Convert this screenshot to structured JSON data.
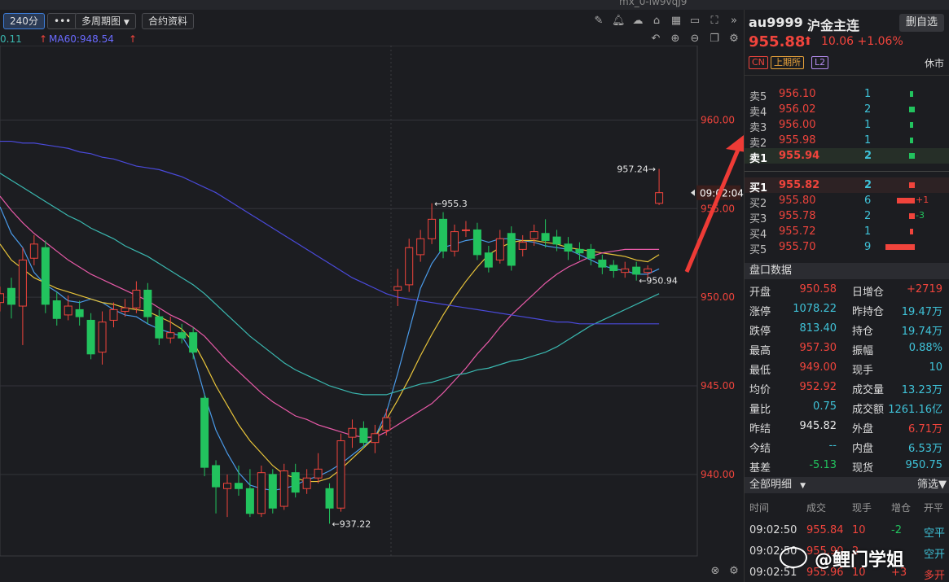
{
  "window": {
    "partial_title": "mx_0-iw9vqJ9"
  },
  "toolbar": {
    "period": "240分",
    "more": "•••",
    "multi_period": "多周期图",
    "contract_info": "合约资料"
  },
  "ma_legend": {
    "left_value": "0.11",
    "ma60": "MA60:948.54"
  },
  "chart_data": {
    "type": "candlestick",
    "y_ticks": [
      "960.00",
      "955.00",
      "950.00",
      "945.00",
      "940.00"
    ],
    "ylim": [
      935.4,
      964.2
    ],
    "current_price_label": "09:02:04",
    "annotations": [
      {
        "text": "957.24",
        "x": 31,
        "y": 957.24
      },
      {
        "text": "955.3",
        "x": 20,
        "y": 955.3
      },
      {
        "text": "950.94",
        "x": 31,
        "y": 950.94
      },
      {
        "text": "937.22",
        "x": 15,
        "y": 937.22
      }
    ],
    "candles": [
      {
        "o": 949.7,
        "c": 950.2,
        "h": 950.6,
        "l": 949.2
      },
      {
        "o": 950.5,
        "c": 949.6,
        "h": 951.1,
        "l": 948.8
      },
      {
        "o": 949.5,
        "c": 952.1,
        "h": 952.8,
        "l": 947.3
      },
      {
        "o": 952.2,
        "c": 953.0,
        "h": 953.5,
        "l": 951.8
      },
      {
        "o": 952.8,
        "c": 949.6,
        "h": 953.2,
        "l": 949.1
      },
      {
        "o": 949.8,
        "c": 948.8,
        "h": 950.3,
        "l": 948.4
      },
      {
        "o": 949.0,
        "c": 949.5,
        "h": 950.1,
        "l": 948.7
      },
      {
        "o": 949.3,
        "c": 948.9,
        "h": 949.8,
        "l": 948.4
      },
      {
        "o": 948.7,
        "c": 946.8,
        "h": 949.1,
        "l": 946.5
      },
      {
        "o": 946.9,
        "c": 948.6,
        "h": 949.2,
        "l": 946.2
      },
      {
        "o": 948.7,
        "c": 949.3,
        "h": 949.7,
        "l": 948.3
      },
      {
        "o": 949.2,
        "c": 949.4,
        "h": 949.9,
        "l": 948.9
      },
      {
        "o": 949.4,
        "c": 950.4,
        "h": 950.9,
        "l": 949.1
      },
      {
        "o": 950.4,
        "c": 948.9,
        "h": 950.8,
        "l": 948.5
      },
      {
        "o": 948.9,
        "c": 947.7,
        "h": 949.3,
        "l": 947.3
      },
      {
        "o": 947.7,
        "c": 948.0,
        "h": 948.9,
        "l": 947.4
      },
      {
        "o": 948.0,
        "c": 947.7,
        "h": 948.5,
        "l": 947.4
      },
      {
        "o": 948.0,
        "c": 946.9,
        "h": 948.3,
        "l": 946.5
      },
      {
        "o": 944.3,
        "c": 940.4,
        "h": 944.5,
        "l": 939.9
      },
      {
        "o": 940.5,
        "c": 939.3,
        "h": 940.8,
        "l": 937.8
      },
      {
        "o": 939.2,
        "c": 939.5,
        "h": 940.0,
        "l": 937.6
      },
      {
        "o": 939.5,
        "c": 939.2,
        "h": 940.5,
        "l": 938.8
      },
      {
        "o": 939.2,
        "c": 937.8,
        "h": 940.3,
        "l": 937.6
      },
      {
        "o": 937.8,
        "c": 940.1,
        "h": 940.5,
        "l": 937.6
      },
      {
        "o": 940.0,
        "c": 938.1,
        "h": 940.3,
        "l": 937.8
      },
      {
        "o": 938.2,
        "c": 940.2,
        "h": 940.6,
        "l": 938.0
      },
      {
        "o": 940.1,
        "c": 939.0,
        "h": 940.6,
        "l": 938.7
      },
      {
        "o": 939.2,
        "c": 939.8,
        "h": 940.3,
        "l": 938.9
      },
      {
        "o": 939.8,
        "c": 940.3,
        "h": 941.2,
        "l": 939.5
      },
      {
        "o": 939.2,
        "c": 938.1,
        "h": 939.5,
        "l": 937.22
      },
      {
        "o": 938.1,
        "c": 941.9,
        "h": 942.3,
        "l": 937.9
      },
      {
        "o": 942.1,
        "c": 942.6,
        "h": 943.1,
        "l": 941.5
      },
      {
        "o": 942.6,
        "c": 941.8,
        "h": 943.0,
        "l": 941.5
      },
      {
        "o": 941.8,
        "c": 942.3,
        "h": 942.8,
        "l": 941.2
      },
      {
        "o": 942.5,
        "c": 943.2,
        "h": 943.7,
        "l": 942.2
      },
      {
        "o": 950.4,
        "c": 950.6,
        "h": 951.6,
        "l": 949.5
      },
      {
        "o": 950.7,
        "c": 952.8,
        "h": 953.3,
        "l": 950.3
      },
      {
        "o": 952.4,
        "c": 953.3,
        "h": 953.8,
        "l": 952.0
      },
      {
        "o": 953.3,
        "c": 954.4,
        "h": 955.3,
        "l": 953.0
      },
      {
        "o": 954.4,
        "c": 952.6,
        "h": 954.8,
        "l": 952.2
      },
      {
        "o": 952.6,
        "c": 953.7,
        "h": 954.1,
        "l": 952.3
      },
      {
        "o": 953.8,
        "c": 953.8,
        "h": 954.3,
        "l": 953.4
      },
      {
        "o": 953.8,
        "c": 952.4,
        "h": 954.2,
        "l": 952.1
      },
      {
        "o": 952.5,
        "c": 951.7,
        "h": 952.9,
        "l": 951.4
      },
      {
        "o": 952.1,
        "c": 953.3,
        "h": 953.8,
        "l": 951.9
      },
      {
        "o": 953.6,
        "c": 951.8,
        "h": 954.0,
        "l": 951.5
      },
      {
        "o": 952.7,
        "c": 953.1,
        "h": 953.5,
        "l": 952.3
      },
      {
        "o": 953.3,
        "c": 953.7,
        "h": 954.1,
        "l": 952.9
      },
      {
        "o": 953.6,
        "c": 953.2,
        "h": 954.4,
        "l": 952.8
      },
      {
        "o": 953.4,
        "c": 953.0,
        "h": 953.8,
        "l": 952.6
      },
      {
        "o": 953.0,
        "c": 952.6,
        "h": 953.4,
        "l": 952.1
      },
      {
        "o": 952.7,
        "c": 952.5,
        "h": 953.1,
        "l": 952.1
      },
      {
        "o": 952.7,
        "c": 952.2,
        "h": 953.0,
        "l": 951.8
      },
      {
        "o": 952.1,
        "c": 951.7,
        "h": 952.4,
        "l": 951.3
      },
      {
        "o": 951.8,
        "c": 951.5,
        "h": 952.1,
        "l": 951.1
      },
      {
        "o": 951.4,
        "c": 951.6,
        "h": 952.0,
        "l": 951.1
      },
      {
        "o": 951.7,
        "c": 951.3,
        "h": 952.0,
        "l": 950.94
      },
      {
        "o": 951.4,
        "c": 951.6,
        "h": 951.8,
        "l": 951.1
      },
      {
        "o": 955.3,
        "c": 955.9,
        "h": 957.24,
        "l": 955.2
      }
    ],
    "series": [
      {
        "color": "#4a9ae8",
        "values": [
          955.1,
          953.6,
          952.8,
          951.4,
          950.7,
          950.3,
          949.8,
          949.7,
          949.9,
          949.7,
          949.3,
          949.0,
          948.9,
          948.5,
          948.2,
          948.0,
          947.8,
          946.8,
          944.5,
          942.5,
          941.2,
          940.1,
          939.4,
          939.2,
          939.1,
          939.2,
          939.4,
          939.7,
          939.9,
          940.2,
          940.6,
          941.1,
          941.6,
          942.1,
          943.5,
          945.7,
          948.1,
          950.5,
          951.9,
          952.8,
          953.0,
          953.2,
          953.3,
          953.1,
          953.3,
          953.3,
          953.2,
          953.1,
          952.9,
          952.8,
          952.7,
          952.4,
          952.1,
          951.8,
          951.6,
          951.5,
          951.3,
          951.3,
          951.6
        ]
      },
      {
        "color": "#e8c43a",
        "values": [
          953.0,
          952.1,
          951.6,
          951.1,
          950.8,
          950.5,
          950.3,
          950.1,
          949.9,
          949.7,
          949.6,
          949.4,
          949.3,
          949.2,
          948.9,
          948.6,
          948.2,
          947.5,
          946.3,
          945.0,
          943.9,
          942.8,
          941.9,
          941.2,
          940.5,
          940.0,
          939.8,
          939.6,
          939.6,
          939.8,
          940.3,
          940.9,
          941.5,
          942.1,
          943.1,
          944.2,
          945.4,
          946.7,
          947.9,
          949.0,
          950.0,
          950.9,
          951.7,
          952.4,
          952.8,
          953.1,
          953.2,
          953.2,
          953.1,
          953.0,
          952.8,
          952.7,
          952.6,
          952.5,
          952.4,
          952.3,
          952.1,
          952.0,
          952.4
        ]
      },
      {
        "color": "#e85aa8",
        "values": [
          955.7,
          954.9,
          954.2,
          953.6,
          953.1,
          952.6,
          952.1,
          951.7,
          951.3,
          951.0,
          950.7,
          950.4,
          950.1,
          949.8,
          949.4,
          949.0,
          948.7,
          948.3,
          947.8,
          947.1,
          946.4,
          945.8,
          945.2,
          944.6,
          944.1,
          943.7,
          943.3,
          943.1,
          942.8,
          942.6,
          942.4,
          942.2,
          942.1,
          942.1,
          942.4,
          942.8,
          943.2,
          943.6,
          944.0,
          944.6,
          945.3,
          946.0,
          946.8,
          947.5,
          948.3,
          949.0,
          949.6,
          950.2,
          950.8,
          951.3,
          951.7,
          952.0,
          952.3,
          952.5,
          952.6,
          952.7,
          952.7,
          952.7,
          952.7
        ]
      },
      {
        "color": "#3ab8b0",
        "values": [
          957.0,
          956.6,
          956.2,
          955.8,
          955.4,
          955.0,
          954.6,
          954.3,
          953.9,
          953.6,
          953.3,
          952.9,
          952.6,
          952.3,
          951.9,
          951.5,
          951.1,
          950.7,
          950.2,
          949.6,
          949.0,
          948.4,
          947.8,
          947.3,
          946.8,
          946.3,
          945.9,
          945.6,
          945.3,
          945.0,
          944.8,
          944.6,
          944.5,
          944.5,
          944.5,
          944.7,
          944.9,
          945.1,
          945.2,
          945.4,
          945.6,
          945.7,
          945.9,
          946.0,
          946.2,
          946.4,
          946.5,
          946.7,
          946.9,
          947.2,
          947.6,
          948.0,
          948.4,
          948.7,
          949.0,
          949.3,
          949.6,
          949.9,
          950.2
        ]
      },
      {
        "color": "#4a4adb",
        "values": [
          958.8,
          958.8,
          958.7,
          958.7,
          958.6,
          958.5,
          958.4,
          958.2,
          958.1,
          957.9,
          957.8,
          957.6,
          957.4,
          957.3,
          957.2,
          957.0,
          956.8,
          956.5,
          956.2,
          955.9,
          955.5,
          955.1,
          954.7,
          954.3,
          953.9,
          953.5,
          953.1,
          952.7,
          952.3,
          951.9,
          951.5,
          951.1,
          950.8,
          950.5,
          950.2,
          950.0,
          949.9,
          949.8,
          949.7,
          949.6,
          949.5,
          949.4,
          949.3,
          949.2,
          949.1,
          949.0,
          948.9,
          948.8,
          948.7,
          948.6,
          948.6,
          948.5,
          948.5,
          948.5,
          948.5,
          948.5,
          948.5,
          948.5,
          948.5
        ]
      }
    ]
  },
  "panel": {
    "symbol": "au9999",
    "name": "沪金主连",
    "delete_btn": "删自选",
    "price": "955.88",
    "change": "10.06",
    "change_pct": "+1.06%",
    "tags": [
      "CN",
      "上期所",
      "L2"
    ],
    "status": "休市",
    "asks": [
      {
        "label": "卖5",
        "price": "956.10",
        "vol": "1",
        "bar": 0.1
      },
      {
        "label": "卖4",
        "price": "956.02",
        "vol": "2",
        "bar": 0.2
      },
      {
        "label": "卖3",
        "price": "956.00",
        "vol": "1",
        "bar": 0.1
      },
      {
        "label": "卖2",
        "price": "955.98",
        "vol": "1",
        "bar": 0.1
      },
      {
        "label": "卖1",
        "price": "955.94",
        "vol": "2",
        "bar": 0.2
      }
    ],
    "bids": [
      {
        "label": "买1",
        "price": "955.82",
        "vol": "2",
        "bar": 0.2,
        "delta": ""
      },
      {
        "label": "买2",
        "price": "955.80",
        "vol": "6",
        "bar": 0.62,
        "delta": "+1"
      },
      {
        "label": "买3",
        "price": "955.78",
        "vol": "2",
        "bar": 0.2,
        "delta": "-3"
      },
      {
        "label": "买4",
        "price": "955.72",
        "vol": "1",
        "bar": 0.1,
        "delta": ""
      },
      {
        "label": "买5",
        "price": "955.70",
        "vol": "9",
        "bar": 1.0,
        "delta": ""
      }
    ],
    "data_header": "盘口数据",
    "data_rows": [
      {
        "l1": "开盘",
        "v1": "950.58",
        "c1": "red",
        "l2": "日增仓",
        "v2": "+2719",
        "c2": "red"
      },
      {
        "l1": "涨停",
        "v1": "1078.22",
        "c1": "cyan",
        "l2": "昨持仓",
        "v2": "19.47万",
        "c2": "cyan"
      },
      {
        "l1": "跌停",
        "v1": "813.40",
        "c1": "cyan",
        "l2": "持仓",
        "v2": "19.74万",
        "c2": "cyan"
      },
      {
        "l1": "最高",
        "v1": "957.30",
        "c1": "red",
        "l2": "振幅",
        "v2": "0.88%",
        "c2": "cyan"
      },
      {
        "l1": "最低",
        "v1": "949.00",
        "c1": "red",
        "l2": "现手",
        "v2": "10",
        "c2": "cyan"
      },
      {
        "l1": "均价",
        "v1": "952.92",
        "c1": "red",
        "l2": "成交量",
        "v2": "13.23万",
        "c2": "cyan"
      },
      {
        "l1": "量比",
        "v1": "0.75",
        "c1": "cyan",
        "l2": "成交额",
        "v2": "1261.16亿",
        "c2": "cyan"
      },
      {
        "l1": "昨结",
        "v1": "945.82",
        "c1": "white",
        "l2": "外盘",
        "v2": "6.71万",
        "c2": "red"
      },
      {
        "l1": "今结",
        "v1": "--",
        "c1": "cyan",
        "l2": "内盘",
        "v2": "6.53万",
        "c2": "cyan"
      },
      {
        "l1": "基差",
        "v1": "-5.13",
        "c1": "green",
        "l2": "现货",
        "v2": "950.75",
        "c2": "cyan"
      }
    ],
    "trades_header": "全部明细",
    "filter": "筛选",
    "trades_cols": [
      "时间",
      "成交",
      "现手",
      "增仓",
      "开平"
    ],
    "trades": [
      {
        "time": "09:02:50",
        "price": "955.84",
        "vol": "10",
        "oi": "-2",
        "type": "空平"
      },
      {
        "time": "09:02:50",
        "price": "955.90",
        "vol": "2",
        "oi": "",
        "type": "空开"
      },
      {
        "time": "09:02:51",
        "price": "955.96",
        "vol": "10",
        "oi": "+3",
        "type": "多开"
      }
    ]
  },
  "watermark": "@鲤门学姐",
  "colors": {
    "up": "#f0443c",
    "down": "#22c35e",
    "cyan": "#3fc3d9",
    "bg": "#1c1d21"
  }
}
